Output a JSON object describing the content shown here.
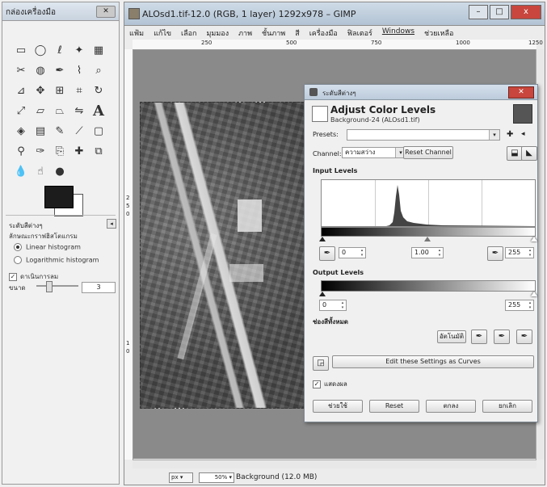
{
  "toolbox": {
    "title": "กล่องเครื่องมือ",
    "options_title": "ระดับสีต่างๆ",
    "histogram_label": "ลักษณะกราฟฮิสโตแกรม",
    "linear": "Linear histogram",
    "log": "Logarithmic histogram",
    "preview": "ดาเนินการลม",
    "size_label": "ขนาด",
    "size_value": "3",
    "tools": [
      "rect-select",
      "ellipse-select",
      "free-select",
      "fuzzy-select",
      "select-by-color",
      "scissors",
      "foreground-select",
      "paths",
      "color-picker",
      "zoom",
      "measure",
      "move",
      "align",
      "crop",
      "rotate",
      "scale",
      "shear",
      "perspective",
      "flip",
      "text",
      "bucket-fill",
      "blend",
      "pencil",
      "paintbrush",
      "eraser",
      "airbrush",
      "ink",
      "clone",
      "heal",
      "perspective-clone",
      "blur",
      "smudge",
      "dodge-burn"
    ]
  },
  "main": {
    "title": "ALOsd1.tif-12.0 (RGB, 1 layer) 1292x978 – GIMP",
    "menus": [
      "แฟ้ม",
      "แก้ไข",
      "เลือก",
      "มุมมอง",
      "ภาพ",
      "ชั้นภาพ",
      "สี",
      "เครื่องมือ",
      "ฟิลเตอร์",
      "Windows",
      "ช่วยเหลือ"
    ],
    "ruler_top": [
      "250",
      "500",
      "750",
      "1000",
      "1250"
    ],
    "ruler_left": [
      "2",
      "5",
      "0",
      "1",
      "0"
    ],
    "unit": "px",
    "zoom": "50%",
    "status": "Background (12.0 MB)",
    "win_min": "–",
    "win_max": "□",
    "win_close": "x"
  },
  "levels": {
    "window_title": "ระดับสีต่างๆ",
    "heading": "Adjust Color Levels",
    "subheading": "Background-24 (ALOsd1.tif)",
    "presets_label": "Presets:",
    "channel_label": "Channel:",
    "channel_value": "ความสว่าง",
    "reset_channel": "Reset Channel",
    "input_levels": "Input Levels",
    "input_low": "0",
    "input_gamma": "1.00",
    "input_high": "255",
    "output_levels": "Output Levels",
    "output_low": "0",
    "output_high": "255",
    "all_channels": "ช่องสีทั้งหมด",
    "auto_button": "อัตโนมัติ",
    "curves_button": "Edit these Settings as Curves",
    "preview_label": "แสดงผล",
    "preview_checked": true,
    "buttons": {
      "help": "ช่วยใช้",
      "reset": "Reset",
      "ok": "ตกลง",
      "cancel": "ยกเลิก"
    }
  }
}
